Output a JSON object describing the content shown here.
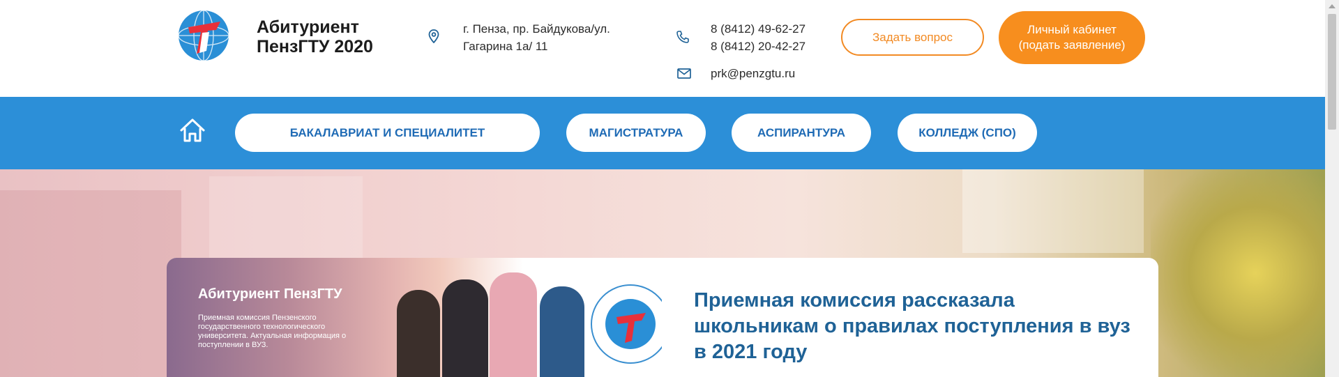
{
  "header": {
    "title_line1": "Абитуриент",
    "title_line2": "ПензГТУ 2020",
    "address_line1": "г. Пенза, пр. Байдукова/ул.",
    "address_line2": "Гагарина 1а/ 11",
    "phone1": "8 (8412) 49-62-27",
    "phone2": "8 (8412) 20-42-27",
    "email": "prk@penzgtu.ru",
    "ask_button": "Задать вопрос",
    "cabinet_line1": "Личный кабинет",
    "cabinet_line2": "(подать заявление)"
  },
  "nav": {
    "items": [
      {
        "label": "БАКАЛАВРИАТ И СПЕЦИАЛИТЕТ"
      },
      {
        "label": "МАГИСТРАТУРА"
      },
      {
        "label": "АСПИРАНТУРА"
      },
      {
        "label": "КОЛЛЕДЖ (СПО)"
      }
    ]
  },
  "news": {
    "image_title": "Абитуриент ПензГТУ",
    "image_text": "Приемная комиссия Пензенского государственного технологического университета. Актуальная информация о поступлении в ВУЗ.",
    "title": "Приемная комиссия рассказала школьникам о правилах поступления в вуз в 2021 году"
  },
  "colors": {
    "accent_orange": "#f78e1e",
    "nav_blue": "#2c8fd8",
    "title_blue": "#1f6296"
  },
  "icons": [
    "logo-icon",
    "location-pin-icon",
    "phone-icon",
    "mail-icon",
    "home-icon"
  ]
}
